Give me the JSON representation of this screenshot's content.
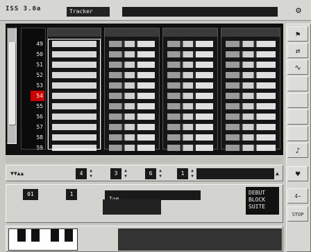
{
  "app": {
    "title": "ISS 3.0a",
    "tab_label": "Tracker"
  },
  "top_icon": "settings-icon",
  "pattern": {
    "row_numbers": [
      "49",
      "50",
      "51",
      "52",
      "53",
      "54",
      "55",
      "56",
      "57",
      "58",
      "59"
    ],
    "current_row": "54",
    "channels": [
      {
        "rows": [
          "",
          "",
          "",
          "",
          "",
          "",
          "",
          "",
          "",
          "",
          ""
        ]
      },
      {
        "rows": [
          "",
          "",
          "",
          "",
          "",
          "",
          "",
          "",
          "",
          "",
          ""
        ]
      },
      {
        "rows": [
          "",
          "",
          "",
          "",
          "",
          "",
          "",
          "",
          "",
          "",
          ""
        ]
      },
      {
        "rows": [
          "",
          "",
          "",
          "",
          "",
          "",
          "",
          "",
          "",
          "",
          ""
        ]
      }
    ]
  },
  "controls": {
    "oct_value": "4",
    "len_value": "3",
    "spd_value": "6",
    "pat_value": "1",
    "name_field": ""
  },
  "instrument": {
    "idx": "01",
    "num": "1",
    "name": "Tom"
  },
  "logo_text": [
    "DEBUT",
    "BLOCK",
    "SUITE"
  ],
  "right_buttons": [
    "flag-icon",
    "arrows-icon",
    "wave-icon",
    "minus-icon",
    "minus-icon",
    "minus-icon",
    "minus-icon",
    "minus-icon",
    "minus-icon",
    "note-icon",
    "heart-icon",
    "step-icon",
    "stop-icon"
  ],
  "right_labels": {
    "wave": "4~",
    "stop": "STOP"
  }
}
